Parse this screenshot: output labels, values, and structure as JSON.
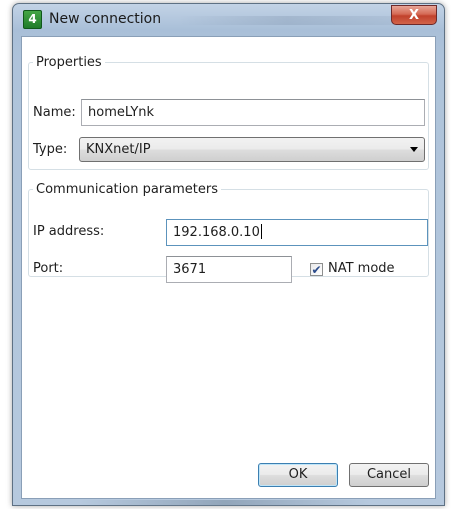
{
  "window": {
    "title": "New connection",
    "app_icon_glyph": "4",
    "close_glyph": "X",
    "colors": {
      "frame": "#aec3da",
      "close_button": "#c1412c",
      "focus_border": "#5c93bc"
    }
  },
  "properties": {
    "legend": "Properties",
    "name_label": "Name:",
    "name_value": "homeLYnk",
    "type_label": "Type:",
    "type_value": "KNXnet/IP"
  },
  "communication": {
    "legend": "Communication parameters",
    "ip_label": "IP address:",
    "ip_value": "192.168.0.10",
    "port_label": "Port:",
    "port_value": "3671",
    "nat_label": "NAT mode",
    "nat_checked": true,
    "check_glyph": "✔"
  },
  "buttons": {
    "ok": "OK",
    "cancel": "Cancel"
  }
}
